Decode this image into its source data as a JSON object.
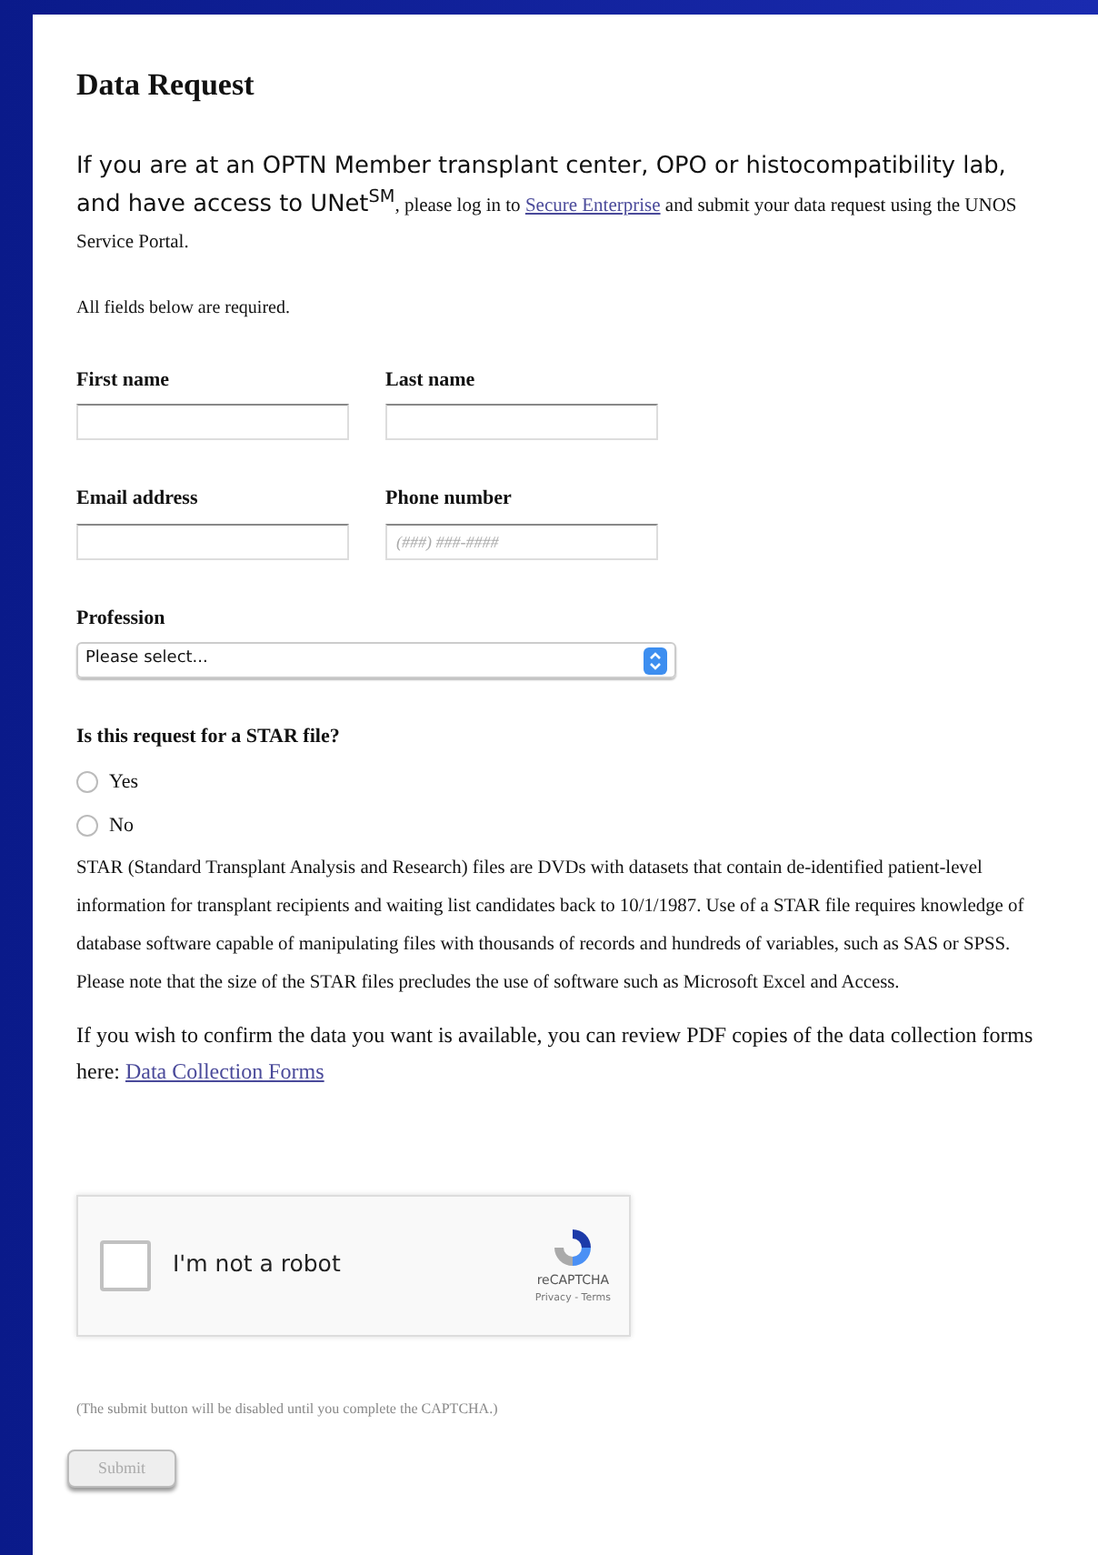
{
  "heading": "Data Request",
  "intro": {
    "lead": "If you are at an OPTN Member transplant center, OPO or histocompatibility lab, and have access to UNet$^{SM}$",
    "before_link": ", please log in to ",
    "link": "Secure Enterprise",
    "after_link": " and submit your data request using the UNOS Service Portal."
  },
  "required_note": "All fields below are required.",
  "field_rows": [
    [
      {
        "label": "First name"
      },
      {
        "label": "Last name"
      }
    ],
    [
      {
        "label": "Email address"
      },
      {
        "label": "Phone number",
        "placeholder": "(###) ###-####"
      }
    ]
  ],
  "profession": {
    "label": "Profession",
    "value": "Please select..."
  },
  "star_question": {
    "label": "Is this request for a STAR file?",
    "options": [
      {
        "label": "Yes",
        "selected": false
      },
      {
        "label": "No",
        "selected": false
      }
    ]
  },
  "star_description": "STAR (Standard Transplant Analysis and Research) files are DVDs with datasets that contain de-identified patient-level information for transplant recipients and waiting list candidates back to 10/1/1987. Use of a STAR file requires knowledge of database software capable of manipulating files with thousands of records and hundreds of variables, such as SAS or SPSS. Please note that the size of the STAR files precludes the use of software such as Microsoft Excel and Access.",
  "forms_note": {
    "text": "If you wish to confirm the data you want is available, you can review PDF copies of the data collection forms here: ",
    "link": "Data Collection Forms"
  },
  "captcha": {
    "label": "I'm not a robot",
    "checked": false,
    "brand": "reCAPTCHA",
    "links": "Privacy - Terms"
  },
  "submit_note": "(The submit button will be disabled until you complete the CAPTCHA.)",
  "submit": {
    "label": "Submit",
    "disabled": true
  }
}
